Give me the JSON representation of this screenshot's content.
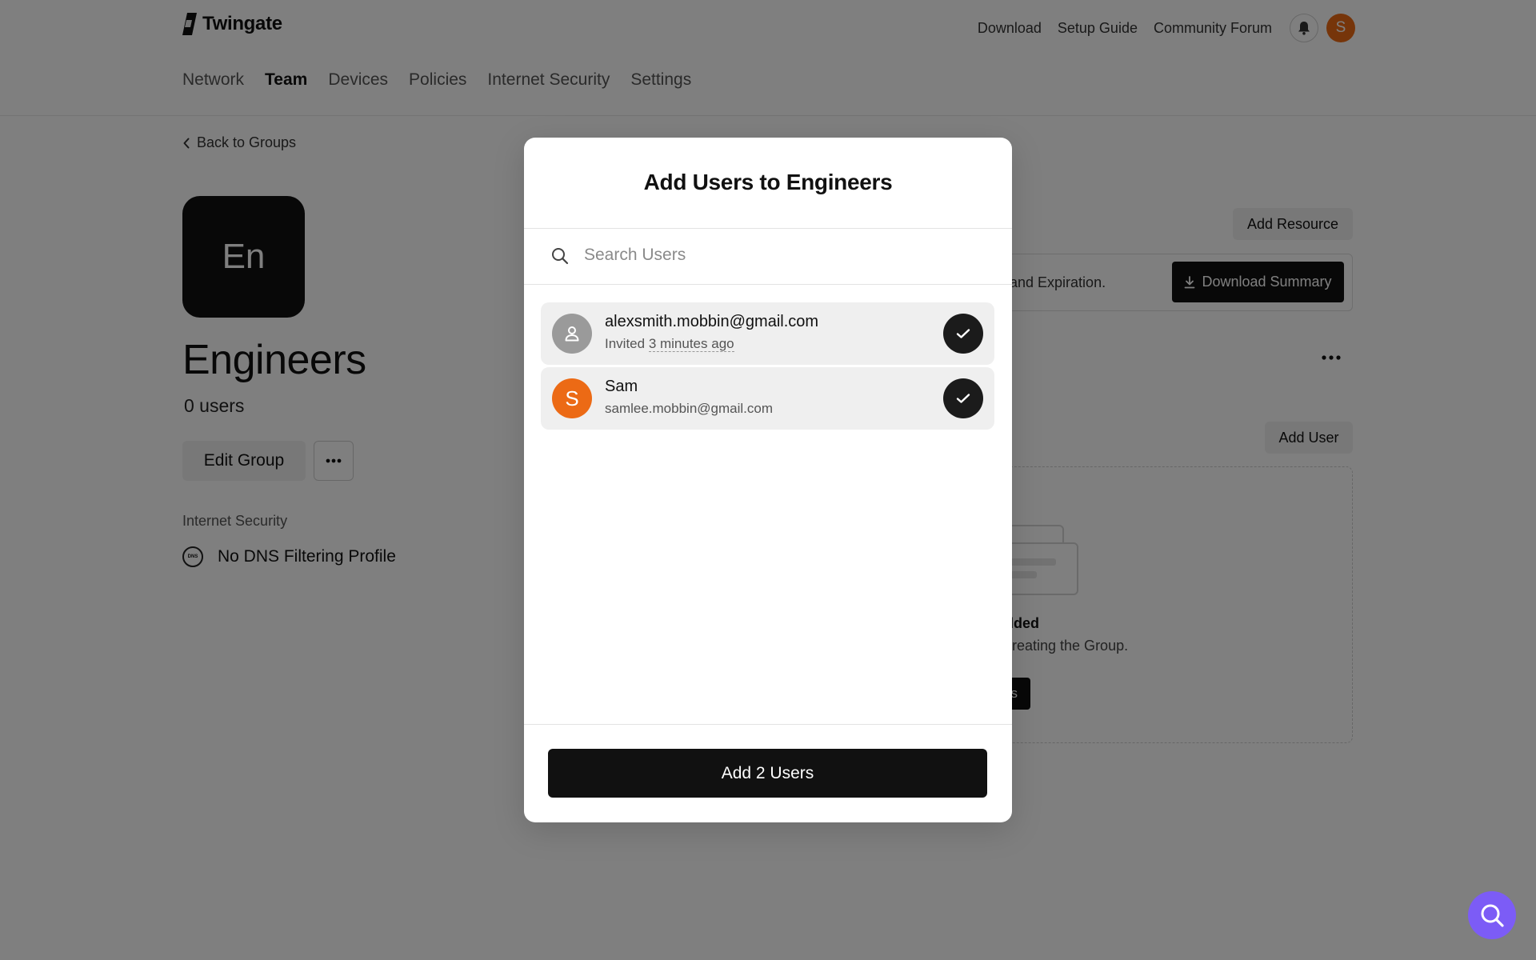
{
  "app": {
    "logo_text": "Twingate"
  },
  "top_links": {
    "download": "Download",
    "setup_guide": "Setup Guide",
    "community_forum": "Community Forum",
    "avatar_initial": "S"
  },
  "nav": {
    "network": "Network",
    "team": "Team",
    "devices": "Devices",
    "policies": "Policies",
    "internet_security": "Internet Security",
    "settings": "Settings"
  },
  "back_link": "Back to Groups",
  "group": {
    "initials": "En",
    "name": "Engineers",
    "count": "0 users",
    "edit_label": "Edit Group",
    "internet_security_label": "Internet Security",
    "dns_icon_text": "DNS",
    "dns_profile": "No DNS Filtering Profile"
  },
  "right_panel": {
    "add_resource": "Add Resource",
    "summary_text": "and Expiration.",
    "download_summary": "Download Summary",
    "add_user": "Add User",
    "empty_title": "dded",
    "empty_sub": "creating the Group.",
    "empty_button": "s"
  },
  "modal": {
    "title": "Add Users to Engineers",
    "search_placeholder": "Search Users",
    "users": [
      {
        "name": "alexsmith.mobbin@gmail.com",
        "sub_prefix": "Invited ",
        "sub_time": "3 minutes ago",
        "selected": true
      },
      {
        "initial": "S",
        "name": "Sam",
        "sub": "samlee.mobbin@gmail.com",
        "selected": true
      }
    ],
    "submit_label": "Add 2 Users"
  },
  "colors": {
    "accent_orange": "#ec6a15",
    "primary_black": "#111111",
    "help_purple": "#7c5cf6"
  }
}
